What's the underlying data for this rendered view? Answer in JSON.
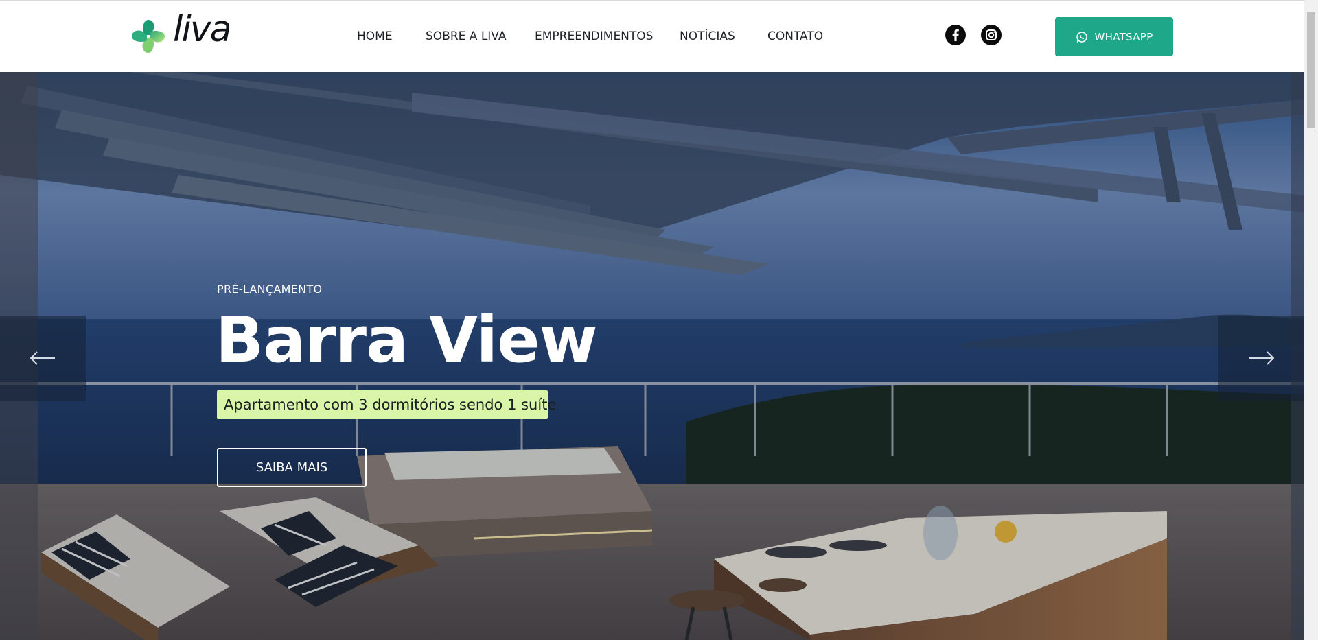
{
  "brand": {
    "logo_text": "liva"
  },
  "nav": {
    "items": [
      {
        "label": "HOME"
      },
      {
        "label": "SOBRE A LIVA"
      },
      {
        "label": "EMPREENDIMENTOS"
      },
      {
        "label": "NOTÍCIAS"
      },
      {
        "label": "CONTATO"
      }
    ]
  },
  "social": {
    "icons": [
      "facebook-icon",
      "instagram-icon"
    ]
  },
  "whatsapp": {
    "label": "WHATSAPP"
  },
  "hero": {
    "eyebrow": "PRÉ-LANÇAMENTO",
    "title": "Barra View",
    "tag": "Apartamento com 3 dormitórios sendo 1 suíte",
    "cta": "SAIBA MAIS"
  },
  "slider": {
    "prev_icon": "arrow-left-icon",
    "next_icon": "arrow-right-icon"
  },
  "colors": {
    "accent": "#1ea889",
    "tag_bg": "#d9f5a8"
  }
}
